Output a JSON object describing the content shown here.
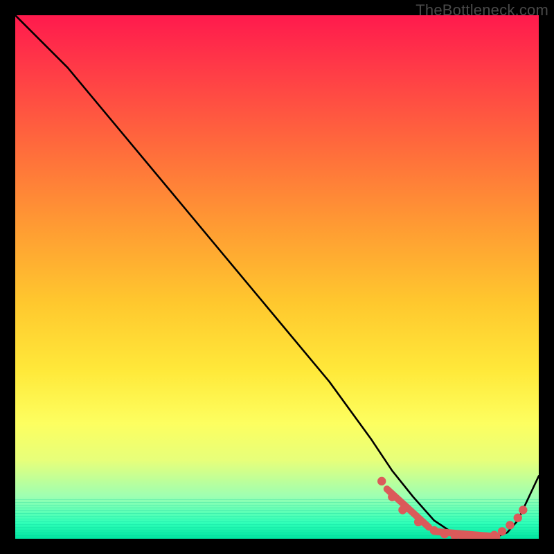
{
  "watermark": "TheBottleneck.com",
  "colors": {
    "marker": "#db5a5a",
    "curve": "#000000"
  },
  "chart_data": {
    "type": "line",
    "title": "",
    "xlabel": "",
    "ylabel": "",
    "xlim": [
      0,
      100
    ],
    "ylim": [
      0,
      100
    ],
    "grid": false,
    "legend": false,
    "series": [
      {
        "name": "bottleneck-curve",
        "x": [
          0,
          5,
          10,
          20,
          30,
          40,
          50,
          60,
          68,
          72,
          76,
          80,
          83,
          86,
          88,
          90,
          92,
          94,
          96,
          100
        ],
        "y": [
          100,
          95,
          90,
          78,
          66,
          54,
          42,
          30,
          19,
          13,
          8,
          3.5,
          1.5,
          0.5,
          0.3,
          0.3,
          0.4,
          1.2,
          3.5,
          12
        ]
      }
    ],
    "markers": [
      {
        "x": 70,
        "y": 11
      },
      {
        "x": 72,
        "y": 8
      },
      {
        "x": 74,
        "y": 5.5
      },
      {
        "x": 77,
        "y": 3.2
      },
      {
        "x": 80,
        "y": 1.6
      },
      {
        "x": 82,
        "y": 0.9
      },
      {
        "x": 84,
        "y": 0.5
      },
      {
        "x": 85.5,
        "y": 0.4
      },
      {
        "x": 87,
        "y": 0.35
      },
      {
        "x": 88.5,
        "y": 0.35
      },
      {
        "x": 90,
        "y": 0.4
      },
      {
        "x": 91.5,
        "y": 0.7
      },
      {
        "x": 93,
        "y": 1.4
      },
      {
        "x": 94.5,
        "y": 2.6
      },
      {
        "x": 96,
        "y": 4
      },
      {
        "x": 97,
        "y": 5.5
      }
    ],
    "marker_segments": [
      {
        "x1": 71,
        "y1": 9.5,
        "x2": 79,
        "y2": 2.2
      },
      {
        "x1": 80,
        "y1": 1.4,
        "x2": 92,
        "y2": 0.4
      }
    ]
  }
}
